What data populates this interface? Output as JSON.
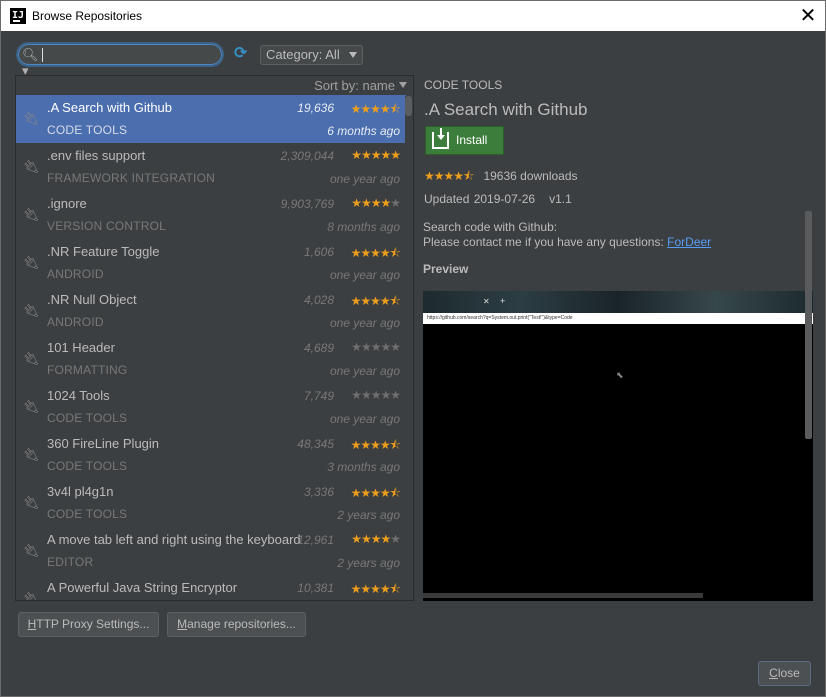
{
  "window": {
    "title": "Browse Repositories",
    "app_icon": "intellij-icon",
    "close_icon": "close-icon"
  },
  "toolbar": {
    "search": {
      "value": "",
      "placeholder": "",
      "icon": "search-icon"
    },
    "refresh_icon": "refresh-icon",
    "category": {
      "label": "Category: All"
    }
  },
  "list": {
    "sort_label": "Sort by: name",
    "items": [
      {
        "name": ".A Search with Github",
        "category": "CODE TOOLS",
        "downloads": "19,636",
        "rating": 4.5,
        "date": "6 months ago",
        "selected": true
      },
      {
        "name": ".env files support",
        "category": "FRAMEWORK INTEGRATION",
        "downloads": "2,309,044",
        "rating": 5,
        "date": "one year ago"
      },
      {
        "name": ".ignore",
        "category": "VERSION CONTROL",
        "downloads": "9,903,769",
        "rating": 4,
        "date": "8 months ago"
      },
      {
        "name": ".NR Feature Toggle",
        "category": "ANDROID",
        "downloads": "1,606",
        "rating": 4.5,
        "date": "one year ago"
      },
      {
        "name": ".NR Null Object",
        "category": "ANDROID",
        "downloads": "4,028",
        "rating": 4.5,
        "date": "one year ago"
      },
      {
        "name": "101 Header",
        "category": "FORMATTING",
        "downloads": "4,689",
        "rating": 0,
        "date": "one year ago"
      },
      {
        "name": "1024 Tools",
        "category": "CODE TOOLS",
        "downloads": "7,749",
        "rating": 0,
        "date": "one year ago"
      },
      {
        "name": "360 FireLine Plugin",
        "category": "CODE TOOLS",
        "downloads": "48,345",
        "rating": 4.5,
        "date": "3 months ago"
      },
      {
        "name": "3v4l pl4g1n",
        "category": "CODE TOOLS",
        "downloads": "3,336",
        "rating": 4.5,
        "date": "2 years ago"
      },
      {
        "name": "A move tab left and right using the keyboard",
        "category": "EDITOR",
        "downloads": "12,961",
        "rating": 4,
        "date": "2 years ago"
      },
      {
        "name": "A Powerful Java String Encryptor",
        "category": "",
        "downloads": "10,381",
        "rating": 4.5,
        "date": ""
      }
    ]
  },
  "detail": {
    "category": "CODE TOOLS",
    "name": ".A Search with Github",
    "install_label": "Install",
    "rating": 4.5,
    "downloads_text": "19636 downloads",
    "updated_text": "Updated 2019-07-26",
    "version_text": "v1.1",
    "description_line1": "Search code with Github:",
    "description_line2": "Please contact me if you have any questions:",
    "link_text": "ForDeer",
    "preview_label": "Preview",
    "preview_url": "https://github.com/search?q=System.out.print(\"Test!\")&type=Code"
  },
  "buttons": {
    "proxy_prefix": "H",
    "proxy_rest": "TTP Proxy Settings...",
    "repos_prefix": "M",
    "repos_rest": "anage repositories...",
    "close_prefix": "C",
    "close_rest": "lose"
  },
  "colors": {
    "selection": "#4b6eaf",
    "star": "#ed9e1d",
    "install": "#3c7d3c",
    "link": "#589df6"
  }
}
